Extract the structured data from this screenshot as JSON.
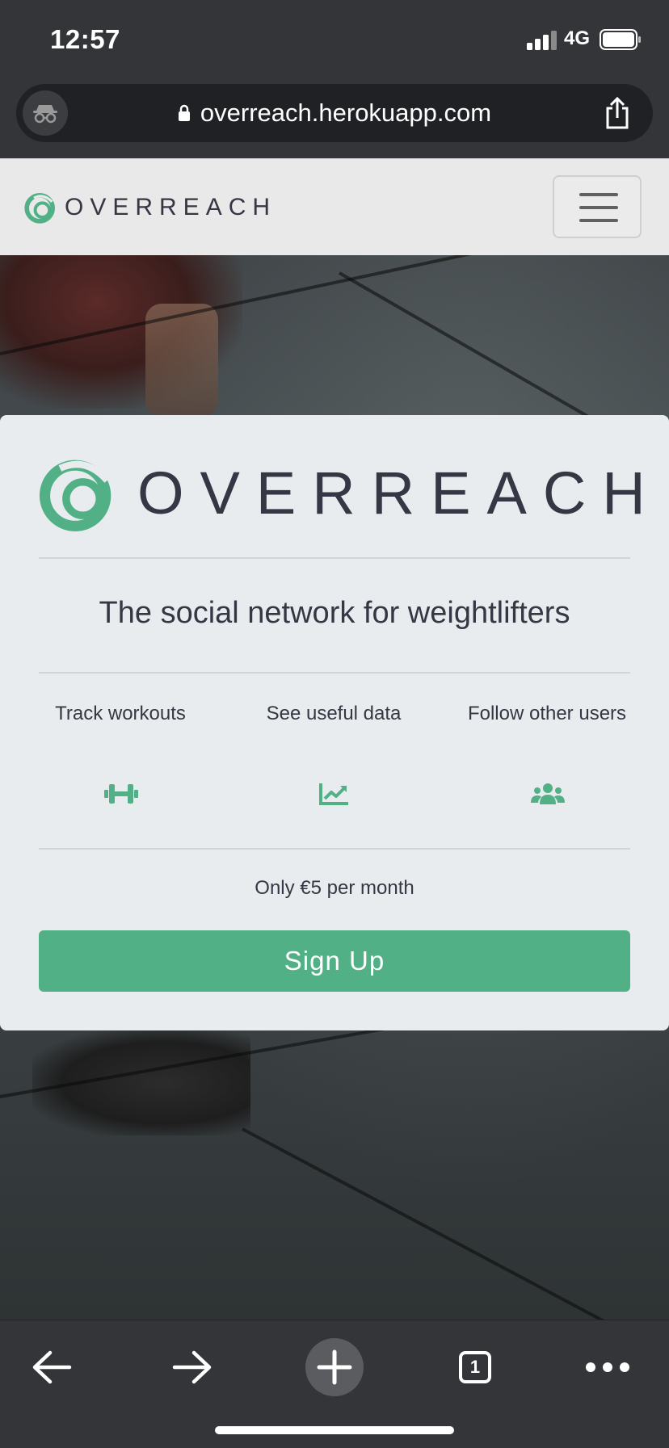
{
  "status_bar": {
    "time": "12:57",
    "network": "4G",
    "icons": [
      "signal-icon",
      "battery-icon"
    ]
  },
  "browser": {
    "url": "overreach.herokuapp.com",
    "icons": [
      "incognito-icon",
      "lock-icon",
      "share-icon"
    ]
  },
  "navbar": {
    "brand": "OVERREACH",
    "icons": [
      "overreach-logo-icon",
      "hamburger-menu-icon"
    ]
  },
  "card": {
    "brand": "OVERREACH",
    "tagline": "The social network for weightlifters",
    "features": [
      {
        "label": "Track workouts",
        "icon": "dumbbell-icon"
      },
      {
        "label": "See useful data",
        "icon": "chart-line-icon"
      },
      {
        "label": "Follow other users",
        "icon": "users-icon"
      }
    ],
    "price": "Only €5 per month",
    "signup_label": "Sign Up"
  },
  "toolbar": {
    "tab_count": "1",
    "icons": [
      "back-arrow-icon",
      "forward-arrow-icon",
      "new-tab-plus-icon",
      "tabs-icon",
      "more-icon"
    ]
  },
  "colors": {
    "accent": "#52b086",
    "text": "#363744",
    "card_bg": "#e9ecef",
    "chrome": "#343538"
  }
}
